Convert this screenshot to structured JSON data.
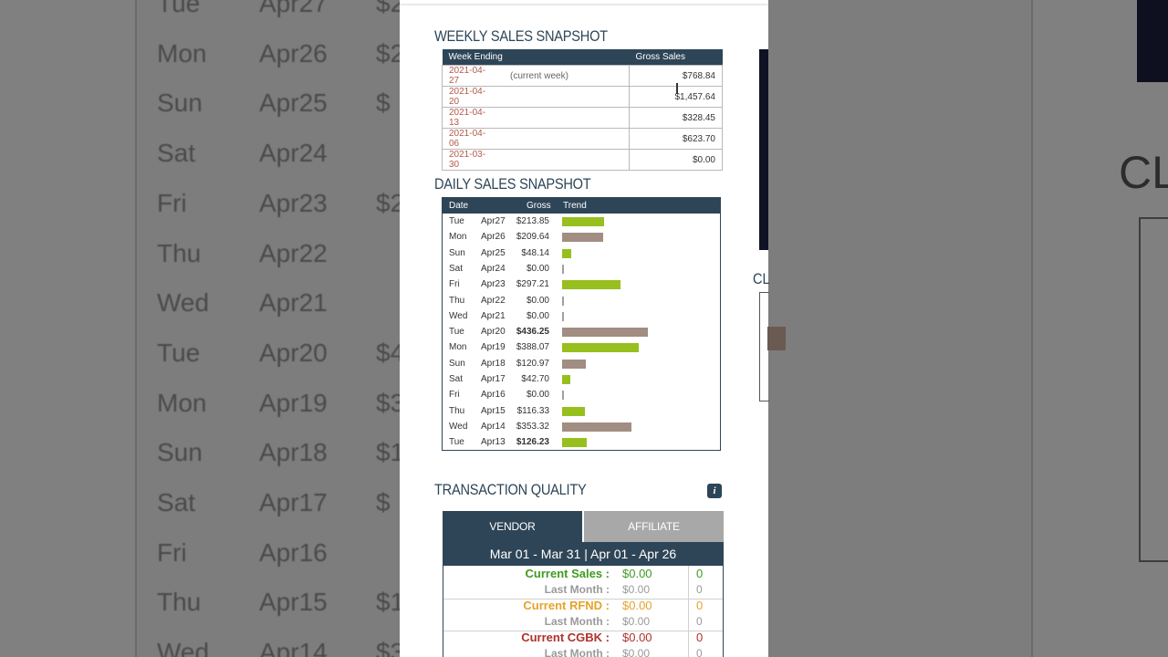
{
  "background_rows": [
    {
      "day": "Tue",
      "date": "Apr27",
      "amt": "$2"
    },
    {
      "day": "Mon",
      "date": "Apr26",
      "amt": "$2"
    },
    {
      "day": "Sun",
      "date": "Apr25",
      "amt": "$"
    },
    {
      "day": "Sat",
      "date": "Apr24",
      "amt": ""
    },
    {
      "day": "Fri",
      "date": "Apr23",
      "amt": "$2"
    },
    {
      "day": "Thu",
      "date": "Apr22",
      "amt": ""
    },
    {
      "day": "Wed",
      "date": "Apr21",
      "amt": ""
    },
    {
      "day": "Tue",
      "date": "Apr20",
      "amt": "$4"
    },
    {
      "day": "Mon",
      "date": "Apr19",
      "amt": "$3"
    },
    {
      "day": "Sun",
      "date": "Apr18",
      "amt": "$1"
    },
    {
      "day": "Sat",
      "date": "Apr17",
      "amt": "$"
    },
    {
      "day": "Fri",
      "date": "Apr16",
      "amt": ""
    },
    {
      "day": "Thu",
      "date": "Apr15",
      "amt": "$1"
    },
    {
      "day": "Wed",
      "date": "Apr14",
      "amt": "$3"
    }
  ],
  "background_heading": "CL",
  "weekly": {
    "title": "WEEKLY SALES SNAPSHOT",
    "headers": [
      "Week Ending",
      "Gross Sales"
    ],
    "rows": [
      {
        "date": "2021-04-27",
        "note": "(current week)",
        "amount": "$768.84"
      },
      {
        "date": "2021-04-20",
        "note": "",
        "amount": "$1,457.64"
      },
      {
        "date": "2021-04-13",
        "note": "",
        "amount": "$328.45"
      },
      {
        "date": "2021-04-06",
        "note": "",
        "amount": "$623.70"
      },
      {
        "date": "2021-03-30",
        "note": "",
        "amount": "$0.00"
      }
    ]
  },
  "daily": {
    "title": "DAILY SALES SNAPSHOT",
    "headers": [
      "Date",
      "Gross",
      "Trend"
    ],
    "colors": {
      "green": "#97bf1e",
      "brown": "#a18d82",
      "thin": "#a0a0a0"
    },
    "max_value": 436.25,
    "rows": [
      {
        "day": "Tue",
        "date": "Apr27",
        "gross": "$213.85",
        "value": 213.85,
        "color": "green",
        "bold": false
      },
      {
        "day": "Mon",
        "date": "Apr26",
        "gross": "$209.64",
        "value": 209.64,
        "color": "brown",
        "bold": false
      },
      {
        "day": "Sun",
        "date": "Apr25",
        "gross": "$48.14",
        "value": 48.14,
        "color": "green",
        "bold": false
      },
      {
        "day": "Sat",
        "date": "Apr24",
        "gross": "$0.00",
        "value": 0,
        "color": "brown",
        "bold": false
      },
      {
        "day": "Fri",
        "date": "Apr23",
        "gross": "$297.21",
        "value": 297.21,
        "color": "green",
        "bold": false
      },
      {
        "day": "Thu",
        "date": "Apr22",
        "gross": "$0.00",
        "value": 0,
        "color": "brown",
        "bold": false
      },
      {
        "day": "Wed",
        "date": "Apr21",
        "gross": "$0.00",
        "value": 0,
        "color": "green",
        "bold": false
      },
      {
        "day": "Tue",
        "date": "Apr20",
        "gross": "$436.25",
        "value": 436.25,
        "color": "brown",
        "bold": true
      },
      {
        "day": "Mon",
        "date": "Apr19",
        "gross": "$388.07",
        "value": 388.07,
        "color": "green",
        "bold": false
      },
      {
        "day": "Sun",
        "date": "Apr18",
        "gross": "$120.97",
        "value": 120.97,
        "color": "brown",
        "bold": false
      },
      {
        "day": "Sat",
        "date": "Apr17",
        "gross": "$42.70",
        "value": 42.7,
        "color": "green",
        "bold": false
      },
      {
        "day": "Fri",
        "date": "Apr16",
        "gross": "$0.00",
        "value": 0,
        "color": "brown",
        "bold": false
      },
      {
        "day": "Thu",
        "date": "Apr15",
        "gross": "$116.33",
        "value": 116.33,
        "color": "green",
        "bold": false
      },
      {
        "day": "Wed",
        "date": "Apr14",
        "gross": "$353.32",
        "value": 353.32,
        "color": "brown",
        "bold": false
      },
      {
        "day": "Tue",
        "date": "Apr13",
        "gross": "$126.23",
        "value": 126.23,
        "color": "green",
        "bold": true
      }
    ]
  },
  "quality": {
    "title": "TRANSACTION QUALITY",
    "info_glyph": "i",
    "tabs": [
      "VENDOR",
      "AFFILIATE"
    ],
    "active_tab": "VENDOR",
    "range": "Mar 01 - Mar 31 | Apr 01 - Apr 26",
    "rows": [
      {
        "label": "Current Sales :",
        "value": "$0.00",
        "count": "0",
        "color": "#3f9a1e",
        "sub": false
      },
      {
        "label": "Last Month :",
        "value": "$0.00",
        "count": "0",
        "color": "#9a9a9a",
        "sub": true
      },
      {
        "label": "Current RFND :",
        "value": "$0.00",
        "count": "0",
        "color": "#e5a32a",
        "sub": false
      },
      {
        "label": "Last Month :",
        "value": "$0.00",
        "count": "0",
        "color": "#9a9a9a",
        "sub": true
      },
      {
        "label": "Current CGBK :",
        "value": "$0.00",
        "count": "0",
        "color": "#b0302a",
        "sub": false
      },
      {
        "label": "Last Month :",
        "value": "$0.00",
        "count": "0",
        "color": "#9a9a9a",
        "sub": true
      }
    ]
  },
  "side_heading": "CL"
}
